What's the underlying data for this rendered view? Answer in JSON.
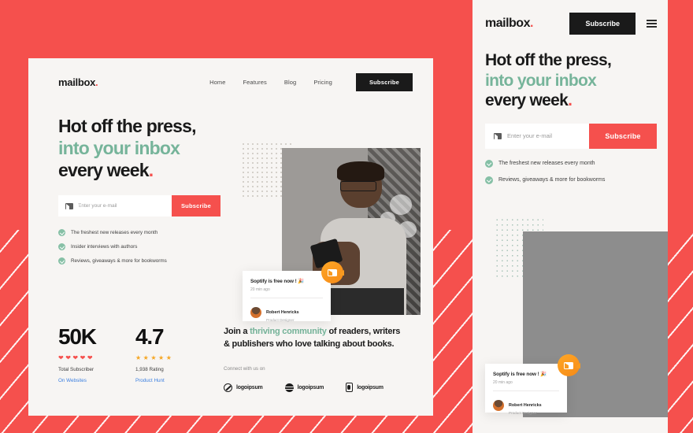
{
  "theme": {
    "accent_red": "#f5504d",
    "accent_green": "#76b49a",
    "panel_bg": "#f7f5f3",
    "dark": "#1a1a1a",
    "link_blue": "#3b7fe0",
    "star_gold": "#f5a623"
  },
  "desktop": {
    "nav": {
      "logo": "mailbox",
      "logo_dot": ".",
      "links": [
        {
          "label": "Home"
        },
        {
          "label": "Features"
        },
        {
          "label": "Blog"
        },
        {
          "label": "Pricing"
        }
      ],
      "subscribe_label": "Subscribe"
    },
    "hero": {
      "headline_line1": "Hot off the press,",
      "headline_line2": "into your inbox",
      "headline_line3": "every week",
      "headline_period": ".",
      "email_placeholder": "Enter your e-mail",
      "email_value": "",
      "subscribe_label": "Subscribe",
      "checklist": [
        {
          "label": "The freshest new releases every month"
        },
        {
          "label": "Insider interviews with authors"
        },
        {
          "label": "Reviews, giveaways & more for bookworms"
        }
      ]
    },
    "notification": {
      "title": "Soptify is free now ! 🎉",
      "time": "20 min ago",
      "user_name": "Robert Henricks",
      "user_role": "Product Designer",
      "badge_icon": "envelope-icon"
    },
    "stats": [
      {
        "number": "50K",
        "icon": "heart",
        "icon_count": 5,
        "label": "Total Subscriber",
        "link": "On Websites"
      },
      {
        "number": "4.7",
        "icon": "star",
        "icon_count": 5,
        "label": "1,938 Rating",
        "link": "Product Hunt"
      }
    ],
    "community": {
      "text_part1": "Join a ",
      "text_highlight": "thriving community",
      "text_part2": " of readers, writers & publishers who love talking about books.",
      "connect_label": "Connect with us on",
      "logos": [
        {
          "name": "logoipsum",
          "mark": "circle-slash-icon"
        },
        {
          "name": "logoipsum",
          "mark": "striped-circle-icon"
        },
        {
          "name": "logoipsum",
          "mark": "book-icon"
        }
      ]
    }
  },
  "mobile": {
    "nav": {
      "logo": "mailbox",
      "logo_dot": ".",
      "subscribe_label": "Subscribe",
      "menu_icon": "hamburger-icon"
    },
    "hero": {
      "headline_line1": "Hot off the press,",
      "headline_line2": "into your inbox",
      "headline_line3": "every week",
      "headline_period": ".",
      "email_placeholder": "Enter your e-mail",
      "email_value": "",
      "subscribe_label": "Subscribe",
      "checklist": [
        {
          "label": "The freshest new releases every month"
        },
        {
          "label": "Reviews, giveaways & more for bookworms"
        }
      ]
    },
    "notification": {
      "title": "Soptify is free now ! 🎉",
      "time": "20 min ago",
      "user_name": "Robert Henricks",
      "user_role": "Product Designer",
      "badge_icon": "envelope-icon"
    }
  }
}
